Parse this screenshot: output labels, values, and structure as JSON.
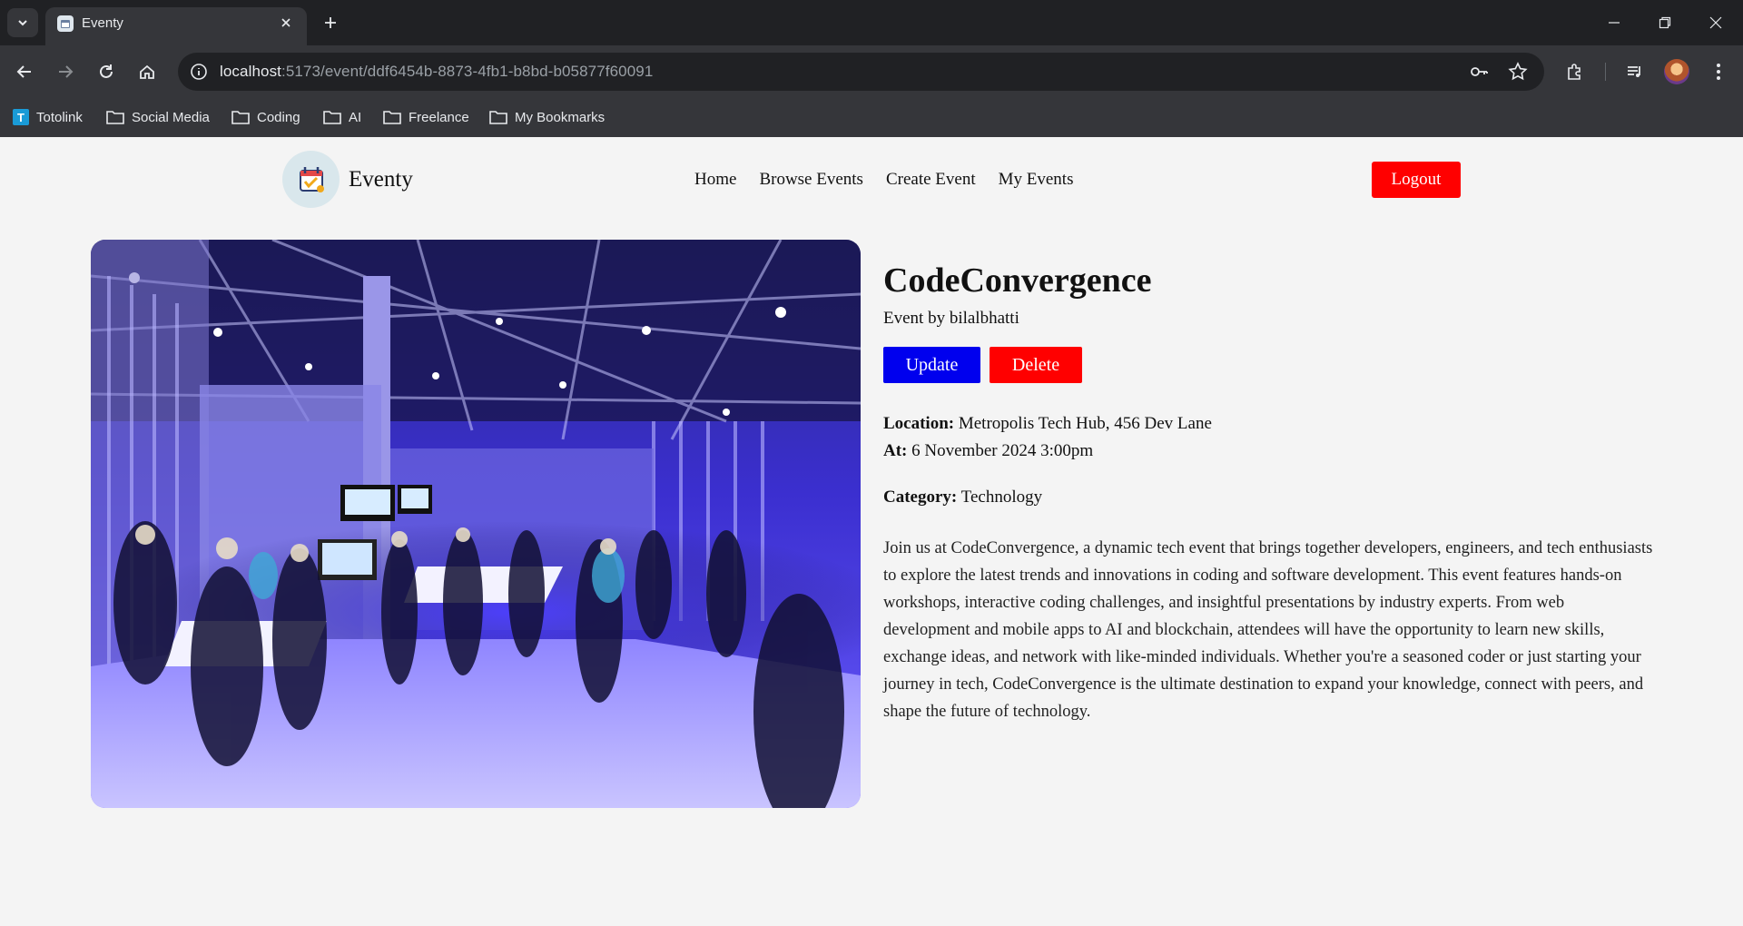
{
  "browser": {
    "tab_title": "Eventy",
    "url_host": "localhost",
    "url_rest": ":5173/event/ddf6454b-8873-4fb1-b8bd-b05877f60091",
    "bookmarks": [
      "Totolink",
      "Social Media",
      "Coding",
      "AI",
      "Freelance",
      "My Bookmarks"
    ]
  },
  "header": {
    "brand": "Eventy",
    "nav": [
      "Home",
      "Browse Events",
      "Create Event",
      "My Events"
    ],
    "logout_label": "Logout"
  },
  "event": {
    "title": "CodeConvergence",
    "byline": "Event by bilalbhatti",
    "update_label": "Update",
    "delete_label": "Delete",
    "location_label": "Location:",
    "location": "Metropolis Tech Hub, 456 Dev Lane",
    "at_label": "At:",
    "at": "6 November 2024 3:00pm",
    "category_label": "Category:",
    "category": "Technology",
    "description": "Join us at CodeConvergence, a dynamic tech event that brings together developers, engineers, and tech enthusiasts to explore the latest trends and innovations in coding and software development. This event features hands-on workshops, interactive coding challenges, and insightful presentations by industry experts. From web development and mobile apps to AI and blockchain, attendees will have the opportunity to learn new skills, exchange ideas, and network with like-minded individuals. Whether you're a seasoned coder or just starting your journey in tech, CodeConvergence is the ultimate destination to expand your knowledge, connect with peers, and shape the future of technology."
  },
  "colors": {
    "update_button": "#0000ee",
    "delete_button": "#ff0000",
    "logout_button": "#ff0000"
  }
}
